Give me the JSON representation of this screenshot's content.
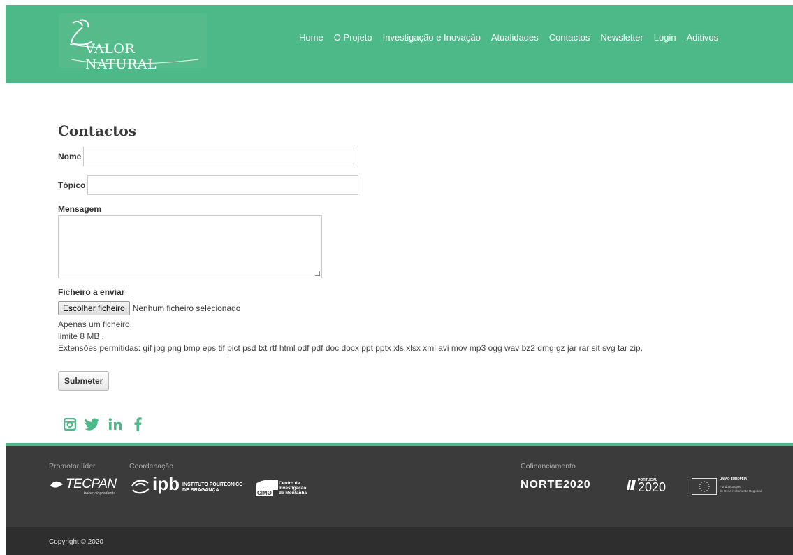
{
  "header": {
    "logo_text": "VALOR NATURAL",
    "nav": [
      "Home",
      "O Projeto",
      "Investigação e Inovação",
      "Atualidades",
      "Contactos",
      "Newsletter",
      "Login",
      "Aditivos"
    ]
  },
  "form": {
    "title": "Contactos",
    "nome_label": "Nome",
    "nome_value": "",
    "topico_label": "Tópico",
    "topico_value": "",
    "mensagem_label": "Mensagem",
    "mensagem_value": "",
    "ficheiro_label": "Ficheiro a enviar",
    "file_button": "Escolher ficheiro",
    "file_status": "Nenhum ficheiro selecionado",
    "help_1": "Apenas um ficheiro.",
    "help_2": "limite 8 MB .",
    "help_3": "Extensões permitidas: gif jpg png bmp eps tif pict psd txt rtf html odf pdf doc docx ppt pptx xls xlsx xml avi mov mp3 ogg wav bz2 dmg gz jar rar sit svg tar zip.",
    "submit": "Submeter"
  },
  "social": [
    "instagram-icon",
    "twitter-icon",
    "linkedin-icon",
    "facebook-icon"
  ],
  "footer": {
    "promotor_label": "Promotor líder",
    "coordenacao_label": "Coordenação",
    "cofinanciamento_label": "Cofinanciamento",
    "tecpan": "TECPAN",
    "tecpan_sub": "bakery ingredients",
    "ipb": "ipb",
    "ipb_sub1": "INSTITUTO POLITÉCNICO",
    "ipb_sub2": "DE BRAGANÇA",
    "cimo": "CIMO",
    "cimo_sub1": "Centro de",
    "cimo_sub2": "Investigação",
    "cimo_sub3": "de Montanha",
    "norte": "NORTE2020",
    "portugal_small": "PORTUGAL",
    "portugal": "2020",
    "ue_1": "UNIÃO EUROPEIA",
    "ue_2": "Fundo Europeu",
    "ue_3": "de Desenvolvimento Regional",
    "copyright": "Copyright © 2020"
  },
  "colors": {
    "brand": "#4db888",
    "footer": "#3b3b3b",
    "footer_bottom": "#2e2e2e"
  }
}
